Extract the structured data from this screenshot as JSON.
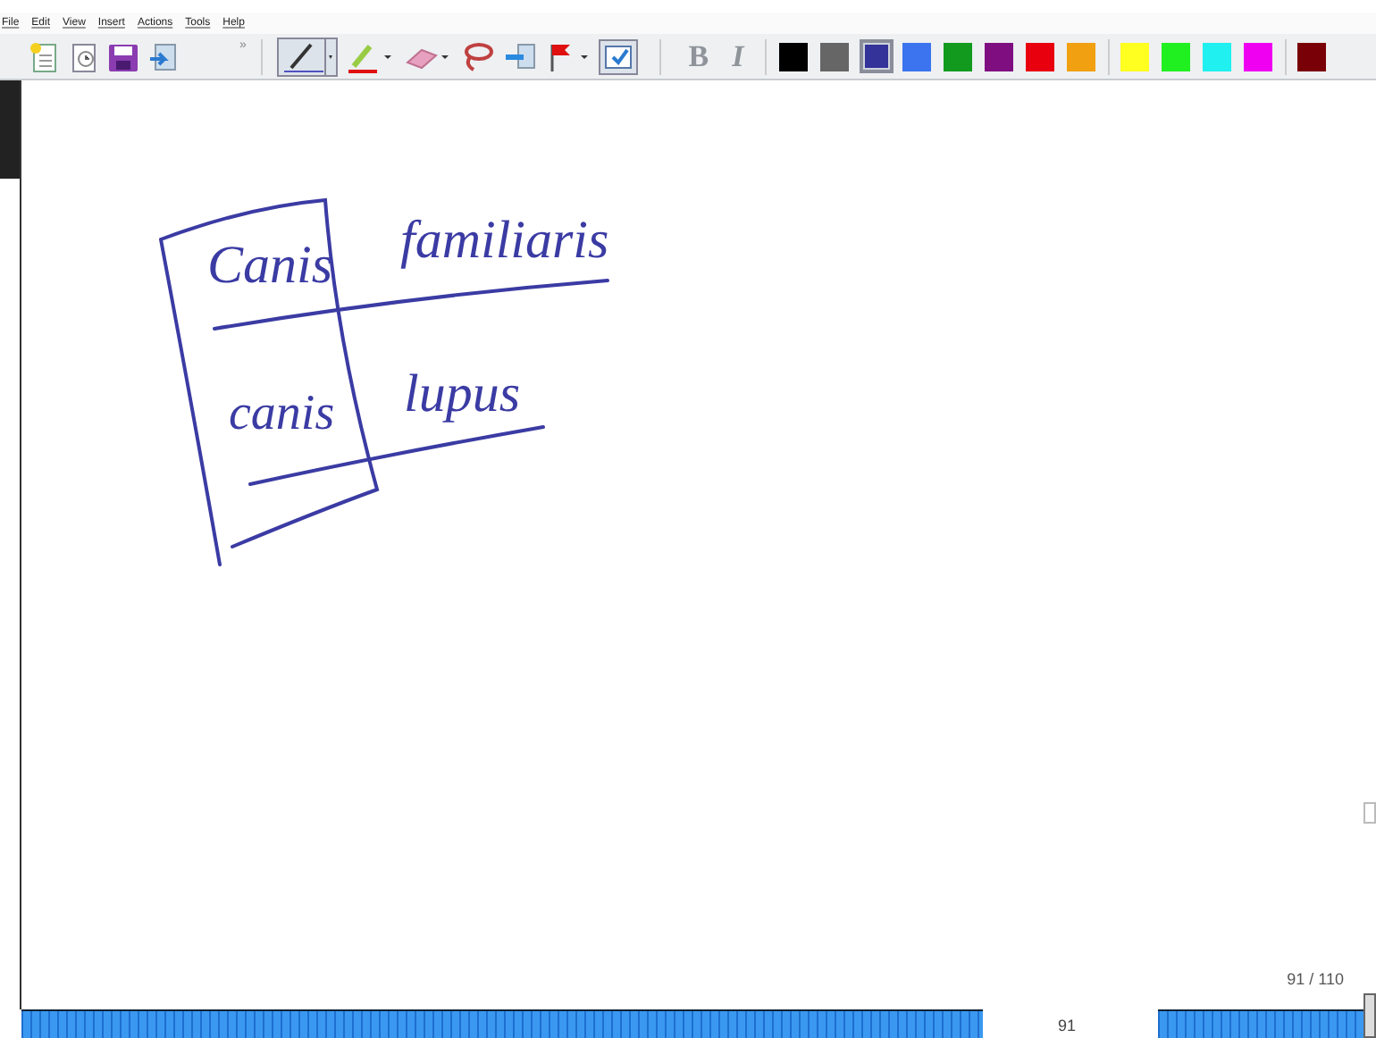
{
  "menu": [
    "File",
    "Edit",
    "View",
    "Insert",
    "Actions",
    "Tools",
    "Help"
  ],
  "format_buttons": [
    {
      "label": "B",
      "disabled": true
    },
    {
      "label": "I",
      "disabled": true
    }
  ],
  "overflow": "»",
  "palette": [
    {
      "color": "#000000",
      "selected": false
    },
    {
      "color": "#666666",
      "selected": false
    },
    {
      "color": "#33339a",
      "selected": true
    },
    {
      "color": "#3b74ee",
      "selected": false
    },
    {
      "color": "#129a1e",
      "selected": false
    },
    {
      "color": "#7f0f80",
      "selected": false
    },
    {
      "color": "#e8000f",
      "selected": false
    },
    {
      "color": "#f0a010",
      "selected": false
    },
    {
      "color": "#ffff20",
      "selected": false
    },
    {
      "color": "#20f020",
      "selected": false
    },
    {
      "color": "#20f0f0",
      "selected": false
    },
    {
      "color": "#f000f0",
      "selected": false
    },
    {
      "color": "#7a0008",
      "selected": false
    }
  ],
  "ink": [
    {
      "text": "Canis"
    },
    {
      "text": "familiaris"
    },
    {
      "text": "canis"
    },
    {
      "text": "lupus"
    }
  ],
  "page_counter": "91 / 110",
  "slide_number": "91"
}
